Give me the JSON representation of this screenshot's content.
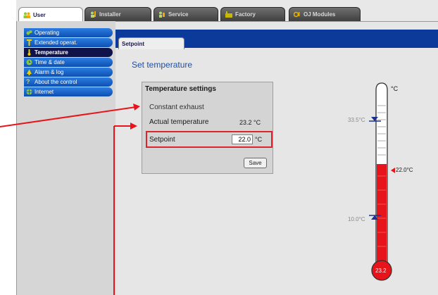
{
  "top_tabs": [
    {
      "label": "User",
      "icon": "users-icon",
      "active": true
    },
    {
      "label": "Installer",
      "icon": "installer-icon",
      "active": false
    },
    {
      "label": "Service",
      "icon": "service-icon",
      "active": false
    },
    {
      "label": "Factory",
      "icon": "factory-icon",
      "active": false
    },
    {
      "label": "OJ Modules",
      "icon": "modules-icon",
      "active": false
    }
  ],
  "sidebar": {
    "items": [
      {
        "label": "Operating",
        "icon": "operating-icon"
      },
      {
        "label": "Extended operat.",
        "icon": "extended-icon"
      },
      {
        "label": "Temperature",
        "icon": "thermometer-icon",
        "active": true
      },
      {
        "label": "Time & date",
        "icon": "clock-icon"
      },
      {
        "label": "Alarm & log",
        "icon": "alarm-icon"
      },
      {
        "label": "About the control",
        "icon": "help-icon"
      },
      {
        "label": "Internet",
        "icon": "internet-icon"
      }
    ]
  },
  "subtab": {
    "label": "Setpoint"
  },
  "page": {
    "title": "Set temperature"
  },
  "panel": {
    "title": "Temperature settings",
    "mode_label": "Constant exhaust",
    "actual_label": "Actual temperature",
    "actual_value": "23.2 °C",
    "setpoint_label": "Setpoint",
    "setpoint_value": "22.0",
    "setpoint_unit": "°C",
    "save_label": "Save"
  },
  "thermometer": {
    "unit": "°C",
    "max_label": "33.5°C",
    "min_label": "10.0°C",
    "setpoint_marker": "22.0°C",
    "bulb_value": "23.2",
    "fill_fraction": 0.68
  },
  "colors": {
    "menu_blue": "#1565d0",
    "menu_active": "#10124a",
    "band_blue": "#0c3a9a",
    "highlight_red": "#d9262c",
    "therm_red": "#e8141b"
  }
}
